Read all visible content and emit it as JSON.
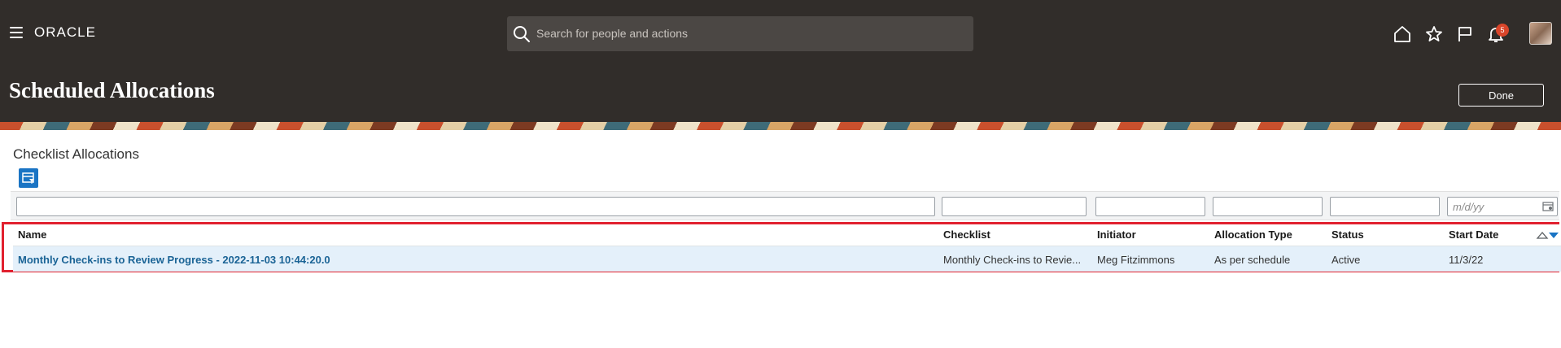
{
  "header": {
    "logo": "ORACLE",
    "search_placeholder": "Search for people and actions",
    "notification_count": "5",
    "page_title": "Scheduled Allocations",
    "done_label": "Done"
  },
  "section": {
    "title": "Checklist Allocations"
  },
  "filters": {
    "date_placeholder": "m/d/yy"
  },
  "table": {
    "columns": [
      "Name",
      "Checklist",
      "Initiator",
      "Allocation Type",
      "Status",
      "Start Date"
    ],
    "rows": [
      {
        "name": "Monthly Check-ins to Review Progress - 2022-11-03 10:44:20.0",
        "checklist": "Monthly Check-ins to Revie...",
        "initiator": "Meg Fitzimmons",
        "allocation_type": "As per schedule",
        "status": "Active",
        "start_date": "11/3/22"
      }
    ]
  },
  "colors": {
    "header_bg": "#312d2a",
    "search_bg": "#4b4744",
    "link": "#1b6496",
    "selected_row": "#e4f0fa",
    "highlight_border": "#e1212f",
    "badge": "#d9452a",
    "filter_button": "#1a74c4"
  },
  "icons": {
    "menu": "hamburger-icon",
    "search": "search-icon",
    "home": "home-icon",
    "favorites": "star-icon",
    "flag": "flag-icon",
    "notifications": "bell-icon",
    "filter": "filter-icon",
    "calendar": "calendar-icon",
    "sort": "sort-icon"
  }
}
